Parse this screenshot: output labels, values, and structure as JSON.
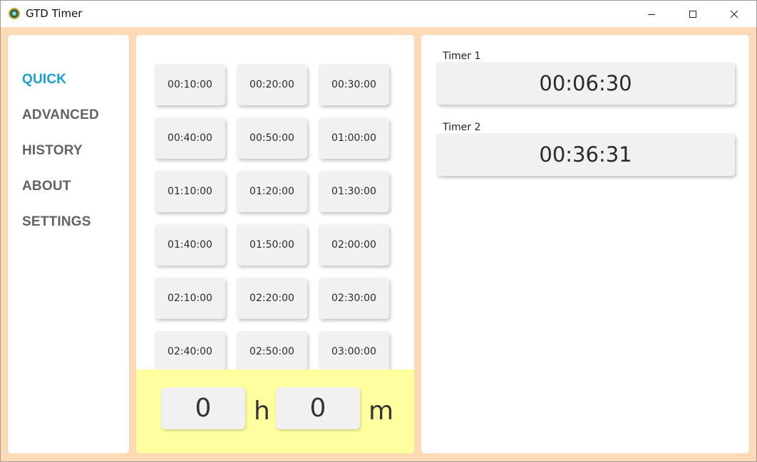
{
  "window": {
    "title": "GTD Timer",
    "icon": "alarm-clock-icon"
  },
  "nav": {
    "items": [
      {
        "label": "QUICK",
        "active": true
      },
      {
        "label": "ADVANCED",
        "active": false
      },
      {
        "label": "HISTORY",
        "active": false
      },
      {
        "label": "ABOUT",
        "active": false
      },
      {
        "label": "SETTINGS",
        "active": false
      }
    ],
    "active_color": "#1a9fd0",
    "inactive_color": "#636363"
  },
  "quick": {
    "presets": [
      "00:10:00",
      "00:20:00",
      "00:30:00",
      "00:40:00",
      "00:50:00",
      "01:00:00",
      "01:10:00",
      "01:20:00",
      "01:30:00",
      "01:40:00",
      "01:50:00",
      "02:00:00",
      "02:10:00",
      "02:20:00",
      "02:30:00",
      "02:40:00",
      "02:50:00",
      "03:00:00"
    ],
    "hours_value": "0",
    "hours_unit": "h",
    "minutes_value": "0",
    "minutes_unit": "m"
  },
  "timers": [
    {
      "label": "Timer 1",
      "time": "00:06:30"
    },
    {
      "label": "Timer 2",
      "time": "00:36:31"
    }
  ],
  "colors": {
    "background": "#fdd9b5",
    "input_area": "#ffff9f",
    "button": "#f1f1f1"
  }
}
